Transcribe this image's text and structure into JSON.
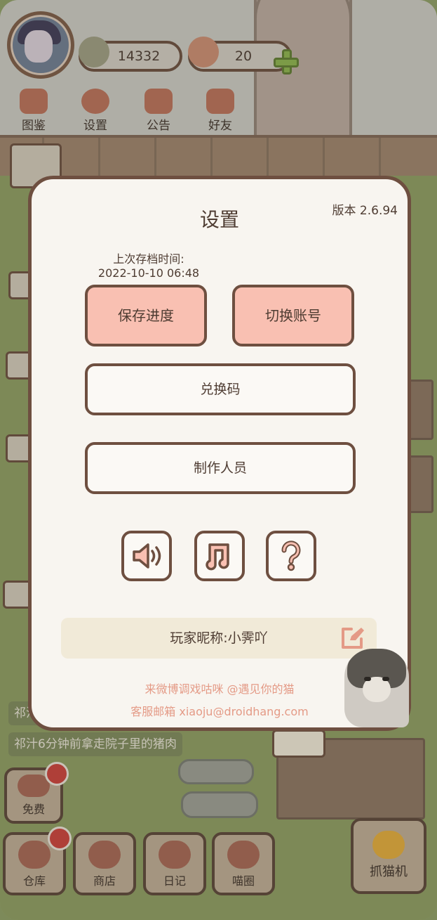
{
  "hud": {
    "fish_count": "14332",
    "heart_count": "20"
  },
  "top_nav": [
    {
      "label": "图鉴"
    },
    {
      "label": "设置"
    },
    {
      "label": "公告"
    },
    {
      "label": "好友"
    }
  ],
  "chat": {
    "line1": "祁汁",
    "line2": "祁汁6分钟前拿走院子里的猪肉"
  },
  "bottom_nav": [
    {
      "label": "免费"
    },
    {
      "label": "仓库"
    },
    {
      "label": "商店"
    },
    {
      "label": "日记"
    },
    {
      "label": "喵圈"
    },
    {
      "label": "抓猫机"
    }
  ],
  "settings": {
    "title": "设置",
    "version": "版本 2.6.94",
    "last_save_label": "上次存档时间:",
    "last_save_time": "2022-10-10 06:48",
    "save_button": "保存进度",
    "switch_account_button": "切换账号",
    "redeem_button": "兑换码",
    "credits_button": "制作人员",
    "icons": [
      "sound-icon",
      "music-icon",
      "help-icon"
    ],
    "nickname_label": "玩家昵称:",
    "nickname": "小霁吖",
    "weibo_line": "来微博调戏咕咪 @遇见你的猫",
    "email_line": "客服邮箱 xiaoju@droidhang.com"
  },
  "colors": {
    "panel_border": "#6e4f40",
    "pink_button": "#f9c0b2",
    "footer_text": "#e49a86",
    "plus_green": "#8ab04c"
  }
}
